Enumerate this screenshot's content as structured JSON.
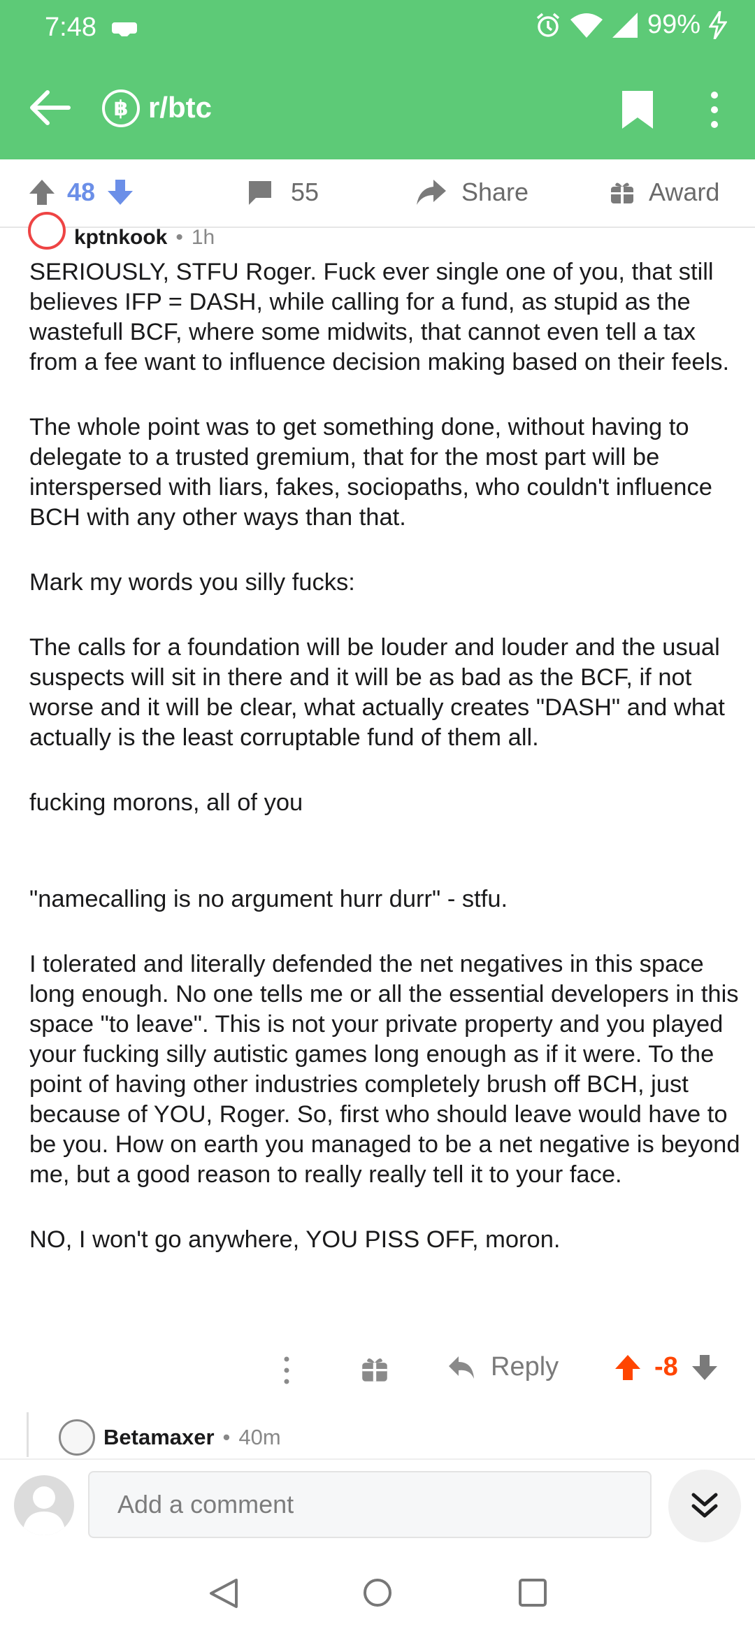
{
  "status": {
    "time": "7:48",
    "battery": "99%"
  },
  "header": {
    "subreddit": "r/btc",
    "sub_icon_glyph": "฿"
  },
  "post_actions": {
    "score": "48",
    "comments": "55",
    "share": "Share",
    "award": "Award"
  },
  "comment": {
    "author": "kptnkook",
    "separator": "•",
    "age": "1h",
    "paragraphs": [
      "SERIOUSLY, STFU Roger. Fuck ever single one of you, that still believes IFP = DASH, while calling for a fund, as stupid as the wastefull BCF, where some midwits, that cannot even tell a tax from a fee want to influence decision making based on their feels.",
      "The whole point was to get something done, without having to delegate to a trusted gremium, that for the most part will be interspersed with liars, fakes, sociopaths, who couldn't influence BCH with any other ways than that.",
      "Mark my words you silly fucks:",
      "The calls for a foundation will be louder and louder and the usual suspects will sit in there and it will be as bad as the BCF, if not worse and it will be clear, what actually creates \"DASH\" and what actually is the least corruptable fund of them all.",
      "fucking morons, all of you",
      "\"namecalling is no argument hurr durr\" - stfu.",
      "I tolerated and literally defended the net negatives in this space long enough. No one tells me or all the essential developers in this space \"to leave\". This is not your private property and you played your fucking silly autistic games long enough as if it were. To the point of having other industries completely brush off BCH, just because of YOU, Roger. So, first who should leave would have to be you. How on earth you managed to be a net negative is beyond me, but a good reason to really really tell it to your face.",
      "NO, I won't go anywhere, YOU PISS OFF, moron."
    ],
    "reply_label": "Reply",
    "score": "-8"
  },
  "child_comment": {
    "author": "Betamaxer",
    "separator": "•",
    "age": "40m"
  },
  "reply_bar": {
    "placeholder": "Add a comment"
  },
  "colors": {
    "brand": "#5dca77",
    "upvote": "#ff4500",
    "score_blue": "#6b8fe8"
  },
  "icons": [
    "back-arrow-icon",
    "subreddit-icon",
    "bookmark-icon",
    "more-vert-icon",
    "upvote-icon",
    "downvote-icon",
    "comment-icon",
    "share-icon",
    "gift-icon",
    "reply-icon",
    "double-chevron-down-icon"
  ]
}
